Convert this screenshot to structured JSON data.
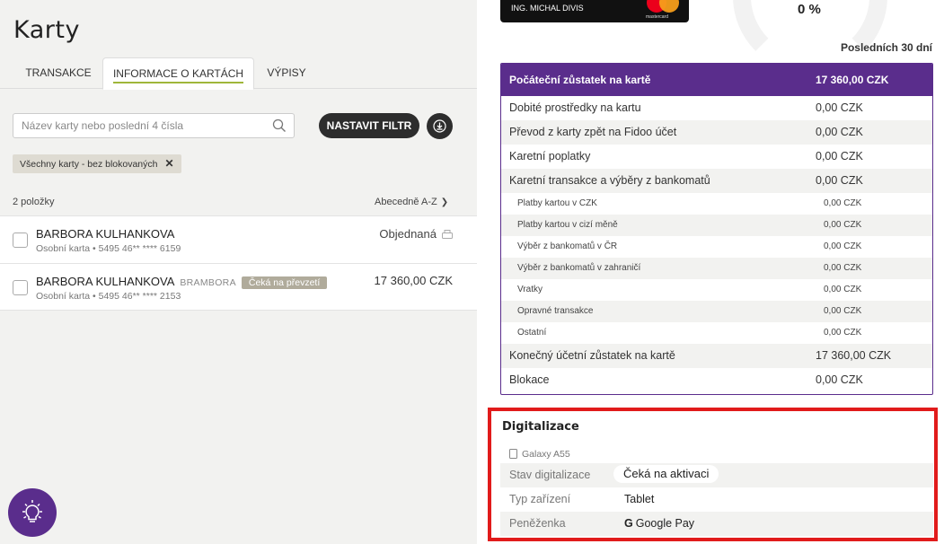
{
  "page": {
    "title": "Karty"
  },
  "tabs": [
    {
      "label": "TRANSAKCE"
    },
    {
      "label": "INFORMACE O KARTÁCH"
    },
    {
      "label": "VÝPISY"
    }
  ],
  "search": {
    "placeholder": "Název karty nebo poslední 4 čísla"
  },
  "toolbar": {
    "filter_label": "NASTAVIT FILTR"
  },
  "active_filter": {
    "label": "Všechny karty - bez blokovaných",
    "remove": "✕"
  },
  "list": {
    "count_label": "2 položky",
    "sort_label": "Abecedně A-Z",
    "items": [
      {
        "name": "BARBORA KULHANKOVA",
        "nickname": "",
        "badge": "",
        "sub": "Osobní karta • 5495 46** **** 6159",
        "status": "Objednaná",
        "amount": ""
      },
      {
        "name": "BARBORA KULHANKOVA",
        "nickname": "BRAMBORA",
        "badge": "Čeká na převzetí",
        "sub": "Osobní karta • 5495 46** **** 2153",
        "status": "",
        "amount": "17 360,00 CZK"
      }
    ]
  },
  "card": {
    "holder": "ING. MICHAL DIVIS",
    "brand": "mastercard",
    "usage_percent": "0 %"
  },
  "summary": {
    "period": "Posledních 30 dní",
    "header": {
      "label": "Počáteční zůstatek na kartě",
      "value": "17 360,00 CZK"
    },
    "rows": [
      {
        "label": "Dobité prostředky na kartu",
        "value": "0,00 CZK"
      },
      {
        "label": "Převod z karty zpět na Fidoo účet",
        "value": "0,00 CZK"
      },
      {
        "label": "Karetní poplatky",
        "value": "0,00 CZK"
      },
      {
        "label": "Karetní transakce a výběry z bankomatů",
        "value": "0,00 CZK"
      }
    ],
    "subrows": [
      {
        "label": "Platby kartou v CZK",
        "value": "0,00 CZK"
      },
      {
        "label": "Platby kartou v cizí měně",
        "value": "0,00 CZK"
      },
      {
        "label": "Výběr z bankomatů v ČR",
        "value": "0,00 CZK"
      },
      {
        "label": "Výběr z bankomatů v zahraničí",
        "value": "0,00 CZK"
      },
      {
        "label": "Vratky",
        "value": "0,00 CZK"
      },
      {
        "label": "Opravné transakce",
        "value": "0,00 CZK"
      },
      {
        "label": "Ostatní",
        "value": "0,00 CZK"
      }
    ],
    "footer": [
      {
        "label": "Konečný účetní zůstatek na kartě",
        "value": "17 360,00 CZK"
      },
      {
        "label": "Blokace",
        "value": "0,00 CZK"
      }
    ]
  },
  "digitalization": {
    "title": "Digitalizace",
    "device_name": "Galaxy A55",
    "rows": [
      {
        "label": "Stav digitalizace",
        "value": "Čeká na aktivaci"
      },
      {
        "label": "Typ zařízení",
        "value": "Tablet"
      },
      {
        "label": "Peněženka",
        "value": "Google Pay",
        "icon": "G"
      }
    ]
  },
  "colors": {
    "brand_purple": "#5a2d8c",
    "highlight_red": "#e11b1b",
    "tab_underline": "#9fb63a"
  }
}
